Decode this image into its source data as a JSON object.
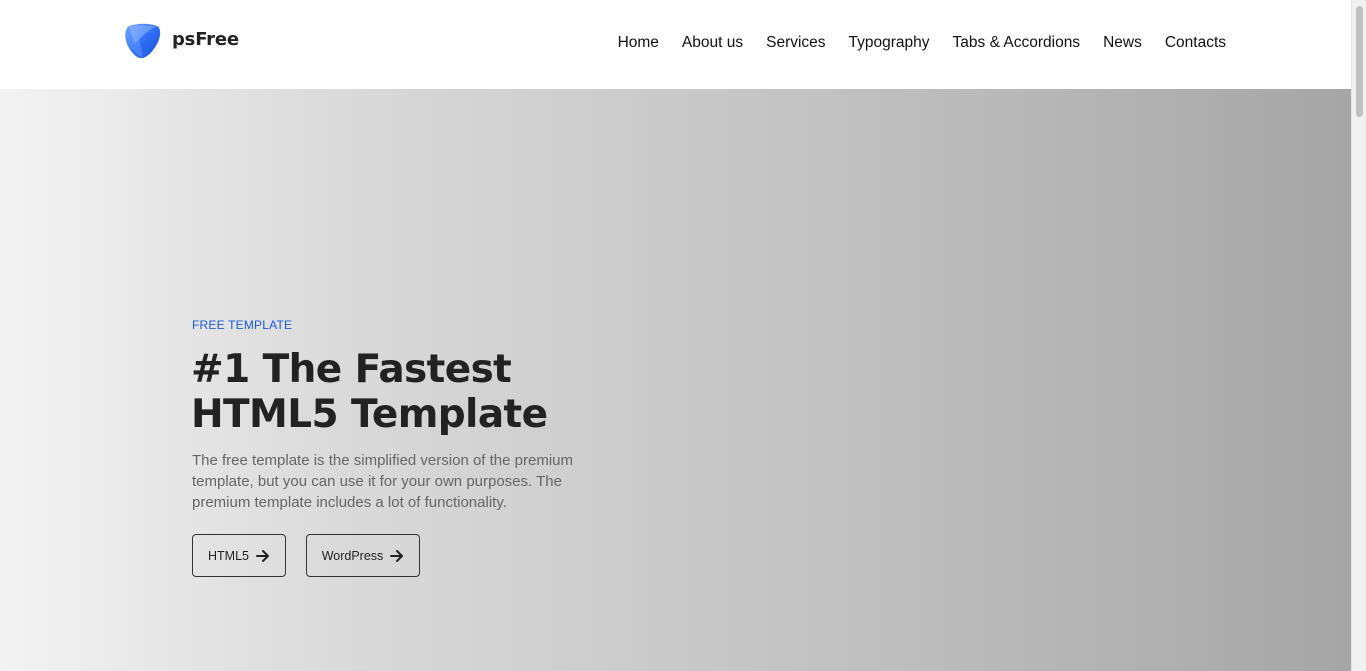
{
  "brand": {
    "name": "psFree",
    "accent_color": "#2a6cf3"
  },
  "nav": {
    "items": [
      {
        "label": "Home"
      },
      {
        "label": "About us"
      },
      {
        "label": "Services"
      },
      {
        "label": "Typography"
      },
      {
        "label": "Tabs & Accordions"
      },
      {
        "label": "News"
      },
      {
        "label": "Contacts"
      }
    ]
  },
  "hero": {
    "eyebrow": "FREE TEMPLATE",
    "title_line1": "#1 The Fastest",
    "title_line2": "HTML5 Template",
    "description": "The free template is the simplified version of the premium template, but you can use it for your own purposes. The premium template includes a lot of functionality.",
    "buttons": [
      {
        "label": "HTML5",
        "icon": "arrow-right-icon"
      },
      {
        "label": "WordPress",
        "icon": "arrow-right-icon"
      }
    ],
    "eyebrow_color": "#1a5bd8"
  }
}
